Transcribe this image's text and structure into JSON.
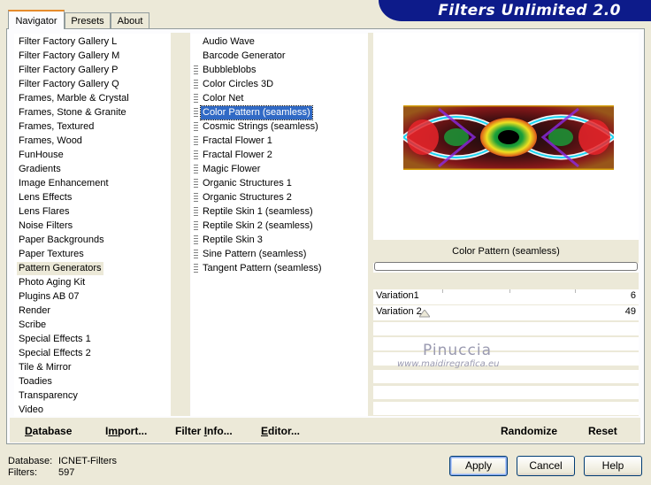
{
  "app": {
    "title": "Filters Unlimited 2.0"
  },
  "tabs": [
    {
      "label": "Navigator",
      "active": true
    },
    {
      "label": "Presets",
      "active": false
    },
    {
      "label": "About",
      "active": false
    }
  ],
  "categories": [
    "Filter Factory Gallery L",
    "Filter Factory Gallery M",
    "Filter Factory Gallery P",
    "Filter Factory Gallery Q",
    "Frames, Marble & Crystal",
    "Frames, Stone & Granite",
    "Frames, Textured",
    "Frames, Wood",
    "FunHouse",
    "Gradients",
    "Image Enhancement",
    "Lens Effects",
    "Lens Flares",
    "Noise Filters",
    "Paper Backgrounds",
    "Paper Textures",
    "Pattern Generators",
    "Photo Aging Kit",
    "Plugins AB 07",
    "Render",
    "Scribe",
    "Special Effects 1",
    "Special Effects 2",
    "Tile & Mirror",
    "Toadies",
    "Transparency",
    "Video"
  ],
  "selected_category": "Pattern Generators",
  "filters": [
    {
      "label": "Audio Wave",
      "grip": false
    },
    {
      "label": "Barcode Generator",
      "grip": false
    },
    {
      "label": "Bubbleblobs",
      "grip": true
    },
    {
      "label": "Color Circles 3D",
      "grip": true
    },
    {
      "label": "Color Net",
      "grip": true
    },
    {
      "label": "Color Pattern (seamless)",
      "grip": true
    },
    {
      "label": "Cosmic Strings (seamless)",
      "grip": true
    },
    {
      "label": "Fractal Flower 1",
      "grip": true
    },
    {
      "label": "Fractal Flower 2",
      "grip": true
    },
    {
      "label": "Magic Flower",
      "grip": true
    },
    {
      "label": "Organic Structures 1",
      "grip": true
    },
    {
      "label": "Organic Structures 2",
      "grip": true
    },
    {
      "label": "Reptile Skin 1 (seamless)",
      "grip": true
    },
    {
      "label": "Reptile Skin 2 (seamless)",
      "grip": true
    },
    {
      "label": "Reptile Skin 3",
      "grip": true
    },
    {
      "label": "Sine Pattern (seamless)",
      "grip": true
    },
    {
      "label": "Tangent Pattern (seamless)",
      "grip": true
    }
  ],
  "selected_filter": "Color Pattern (seamless)",
  "preview": {
    "filter_name": "Color Pattern (seamless)",
    "progress": 0
  },
  "sliders": [
    {
      "label": "Variation1",
      "value": "6"
    },
    {
      "label": "Variation 2",
      "value": "49"
    }
  ],
  "watermark": {
    "name": "Pinuccia",
    "url": "www.maidiregrafica.eu"
  },
  "bottom_links": {
    "database": {
      "first": "D",
      "rest": "atabase"
    },
    "import": {
      "first": "I",
      "mid": "m",
      "rest": "port..."
    },
    "filter_info": {
      "first": "F",
      "mid": "ilter ",
      "u2": "I",
      "rest": "nfo..."
    },
    "editor": {
      "first": "E",
      "rest": "ditor..."
    },
    "randomize": "Randomize",
    "reset": "Reset"
  },
  "status": {
    "database_label": "Database:",
    "database_value": "ICNET-Filters",
    "filters_label": "Filters:",
    "filters_value": "597"
  },
  "buttons": {
    "apply": "Apply",
    "cancel": "Cancel",
    "help": "Help"
  },
  "colors": {
    "banner": "#0d1b8a",
    "selection": "#316ac5",
    "tab_accent": "#e68b2c"
  }
}
